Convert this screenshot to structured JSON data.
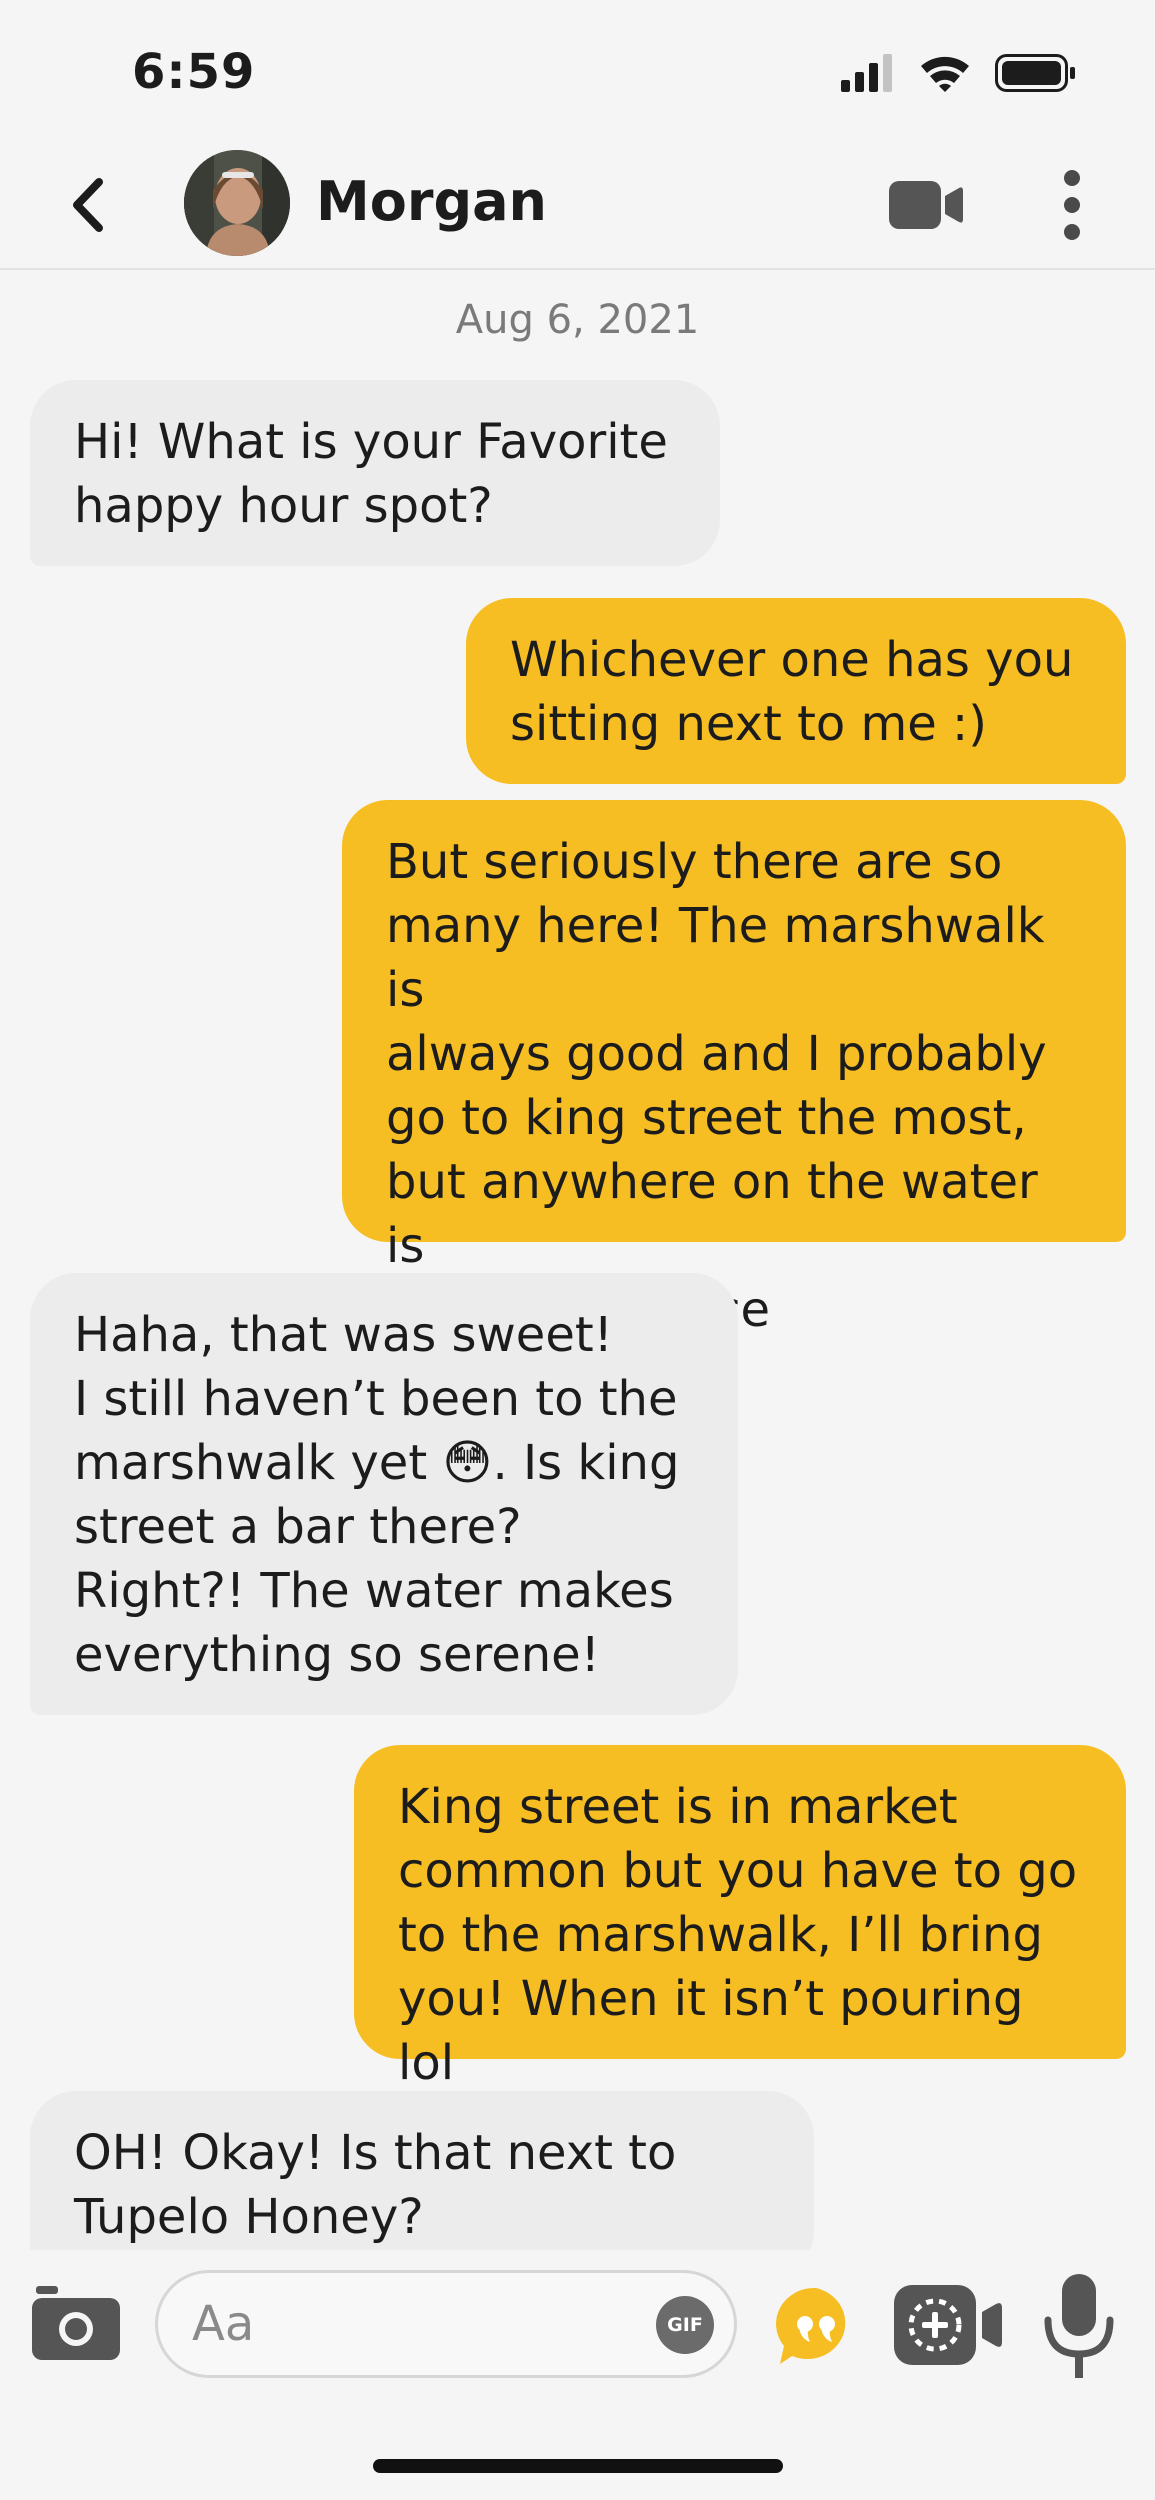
{
  "status_bar": {
    "time": "6:59"
  },
  "header": {
    "contact_name": "Morgan"
  },
  "conversation": {
    "date": "Aug 6, 2021",
    "messages": [
      {
        "direction": "incoming",
        "text": "Hi! What is your Favorite\nhappy hour spot?"
      },
      {
        "direction": "outgoing",
        "text": "Whichever one has you\nsitting next to me :)"
      },
      {
        "direction": "outgoing",
        "text": "But seriously there are so\nmany here! The marshwalk is\nalways good and I probably\ngo to king street the most,\nbut anywhere on the water is\nmy happy place"
      },
      {
        "direction": "incoming",
        "text": "Haha, that was sweet!\nI still haven’t been to the\nmarshwalk yet 😳. Is king\nstreet a bar there?\nRight?! The water makes\neverything so serene!"
      },
      {
        "direction": "outgoing",
        "text": "King street is in market\ncommon but you have to go\nto the marshwalk, I’ll bring\nyou! When it isn’t pouring lol"
      },
      {
        "direction": "incoming",
        "text": "OH! Okay! Is that next to\nTupelo Honey?"
      }
    ]
  },
  "composer": {
    "placeholder": "Aa",
    "value": "",
    "gif_label": "GIF",
    "icons": [
      "camera-icon",
      "gif-icon",
      "quote-icon",
      "add-media-icon",
      "microphone-icon"
    ]
  },
  "colors": {
    "outgoing_bubble": "#f6be22",
    "incoming_bubble": "#ececec",
    "background": "#f5f5f5",
    "accent": "#f6be22"
  }
}
